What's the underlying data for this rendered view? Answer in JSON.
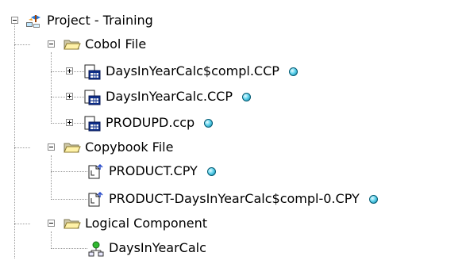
{
  "tree": {
    "root": {
      "label": "Project - Training",
      "icon": "project-icon"
    },
    "folders": [
      {
        "label": "Cobol File",
        "icon": "folder-open-icon",
        "items": [
          {
            "label": "DaysInYearCalc$compl.CCP",
            "icon": "cobol-program-icon",
            "status": "active",
            "expandable": true
          },
          {
            "label": "DaysInYearCalc.CCP",
            "icon": "cobol-program-icon",
            "status": "active",
            "expandable": true
          },
          {
            "label": "PRODUPD.ccp",
            "icon": "cobol-program-icon",
            "status": "active",
            "expandable": true
          }
        ]
      },
      {
        "label": "Copybook File",
        "icon": "folder-open-icon",
        "items": [
          {
            "label": "PRODUCT.CPY",
            "icon": "copybook-icon",
            "status": "active",
            "expandable": false
          },
          {
            "label": "PRODUCT-DaysInYearCalc$compl-0.CPY",
            "icon": "copybook-icon",
            "status": "active",
            "expandable": false
          }
        ]
      },
      {
        "label": "Logical Component",
        "icon": "folder-open-icon",
        "items": [
          {
            "label": "DaysInYearCalc",
            "icon": "logical-component-icon",
            "expandable": false
          }
        ]
      }
    ],
    "status_colors": {
      "active": "#3ec6e6"
    }
  }
}
